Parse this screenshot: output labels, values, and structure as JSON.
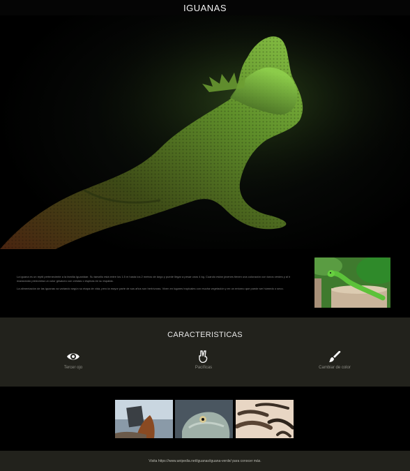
{
  "header": {
    "title": "IGUANAS"
  },
  "hero": {
    "image_alt": "iguana verde sobre fondo oscuro"
  },
  "intro": {
    "paragraphs": [
      "La iguana es un reptil perteneciente a la familia Iguanidae. Su tamaño está entre los 1.5 m hasta los 2 metros de largo y puede llegar a pesar unos 4 kg. Cuando están jóvenes tienen una coloración con tonos verdes y al ir madurando predomina un color grisáceo con crestas o espinas en su espalda.",
      "La alimentación de las iguanas va variando según su etapa de vida, pero la mayor parte de sus años son herbívoras. Viven en lugares tropicales con mucha vegetación y en un entorno que puede ser húmedo o seco."
    ]
  },
  "features": {
    "title": "CARACTERISTICAS",
    "items": [
      {
        "label": "Tercer ojo",
        "icon": "eye-icon"
      },
      {
        "label": "Pacíficas",
        "icon": "peace-hand-icon"
      },
      {
        "label": "Cambiar de color",
        "icon": "paintbrush-icon"
      }
    ]
  },
  "gallery": {
    "images": [
      {
        "alt": "iguanas en la playa"
      },
      {
        "alt": "cabeza de iguana"
      },
      {
        "alt": "grupo de iguanas"
      }
    ]
  },
  "footer": {
    "text": "Visita https://www.anipedia.net/iguanas/iguana-verde/ para conocer más."
  },
  "colors": {
    "background": "#000000",
    "section": "#22221c",
    "accent_green": "#6aa03a"
  }
}
